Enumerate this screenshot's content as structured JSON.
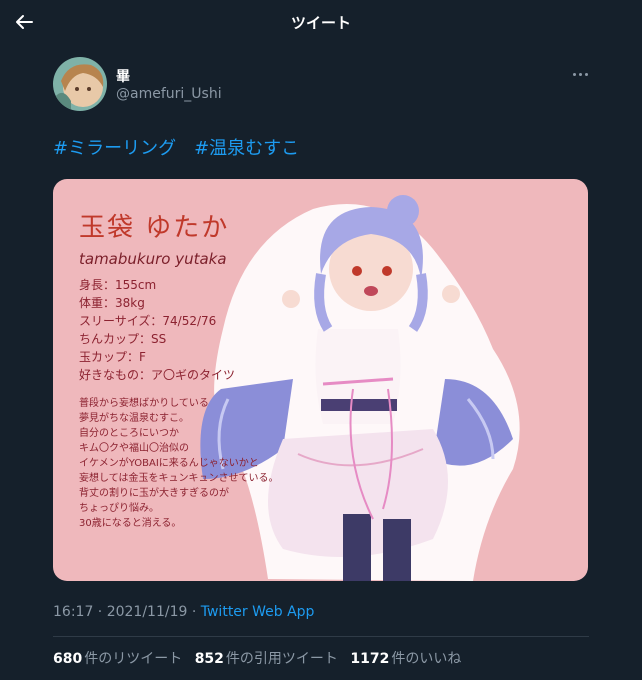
{
  "header": {
    "title": "ツイート",
    "back_icon": "arrow-left-icon"
  },
  "tweet": {
    "author": {
      "name": "畢",
      "handle": "@amefuri_Ushi"
    },
    "hashtags": [
      "#ミラーリング",
      "#温泉むすこ"
    ],
    "card": {
      "name_jp": "玉袋 ゆたか",
      "name_romaji": "tamabukuro yutaka",
      "stats": [
        "身長：155cm",
        "体重：38kg",
        "スリーサイズ：74/52/76",
        "ちんカップ：SS",
        "玉カップ：F",
        "好きなもの：ア〇ギのタイツ"
      ],
      "bio": [
        "普段から妄想ばかりしている",
        "夢見がちな温泉むすこ。",
        "自分のところにいつか",
        "キム〇クや福山〇治似の",
        "イケメンがYOBAIに来るんじゃないかと",
        "妄想しては金玉をキュンキュンさせている。",
        "背丈の割りに玉が大きすぎるのが",
        "ちょっぴり悩み。",
        "30歳になると消える。"
      ]
    },
    "timestamp": "16:17 · 2021/11/19 · ",
    "source": "Twitter Web App",
    "stats": {
      "retweets": "680",
      "retweets_label": "件のリツイート",
      "quotes": "852",
      "quotes_label": "件の引用ツイート",
      "likes": "1172",
      "likes_label": "件のいいね"
    }
  },
  "colors": {
    "background": "#15202b",
    "accent": "#1d9bf0",
    "muted": "#8b98a5",
    "card_bg": "#efb8bc"
  }
}
